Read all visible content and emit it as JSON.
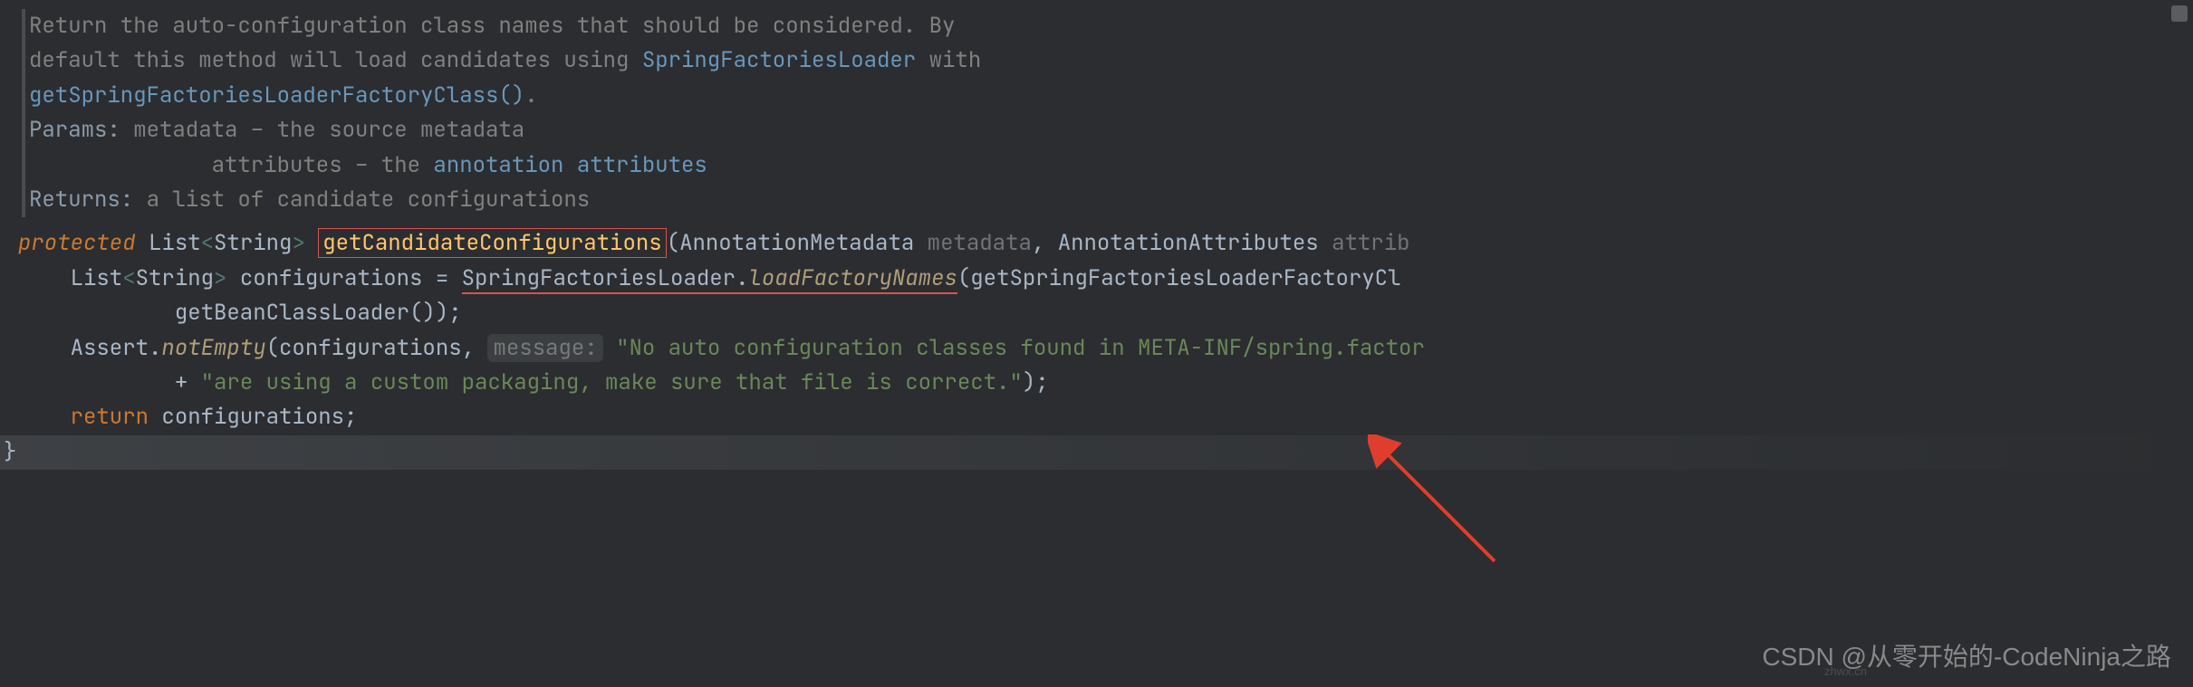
{
  "javadoc": {
    "line1a": "Return the auto-configuration class names that should be considered. By",
    "line2a": "default this method will load candidates using ",
    "line2b": "SpringFactoriesLoader",
    "line2c": " with",
    "line3a": "getSpringFactoriesLoaderFactoryClass()",
    "line3b": ".",
    "params_label": "Params: ",
    "param1": "metadata – the source metadata",
    "param2_pad": "              ",
    "param2a": "attributes – the ",
    "param2b": "annotation",
    "param2c": " ",
    "param2d": "attributes",
    "returns_label": "Returns: ",
    "returns_text": "a list of candidate configurations"
  },
  "code": {
    "protected": "protected",
    "list": "List",
    "lt": "<",
    "string": "String",
    "gt": ">",
    "space": " ",
    "method": "getCandidateConfigurations",
    "lparen": "(",
    "annoMeta": "AnnotationMetadata",
    "metadata": "metadata",
    "comma": ", ",
    "annoAttr": "AnnotationAttributes",
    "attrib": "attrib",
    "indent2": "    ",
    "indent3": "            ",
    "configurations": "configurations",
    "eq": " = ",
    "sfl": "SpringFactoriesLoader",
    "dot": ".",
    "lfn": "loadFactoryNames",
    "gsflfc": "getSpringFactoriesLoaderFactoryCl",
    "gbcl": "getBeanClassLoader",
    "rparen": ")",
    "rparen2": ");",
    "assert": "Assert",
    "notEmpty": "notEmpty",
    "hint_msg": "message:",
    "str1": "\"No auto configuration classes found in META-INF/spring.factor",
    "plus": "+ ",
    "str2": "\"are using a custom packaging, make sure that file is correct.\"",
    "return": "return",
    "semi": ";",
    "rbrace": "}"
  },
  "watermark": "CSDN @从零开始的-CodeNinja之路",
  "watermark2": "zhwx.cn"
}
